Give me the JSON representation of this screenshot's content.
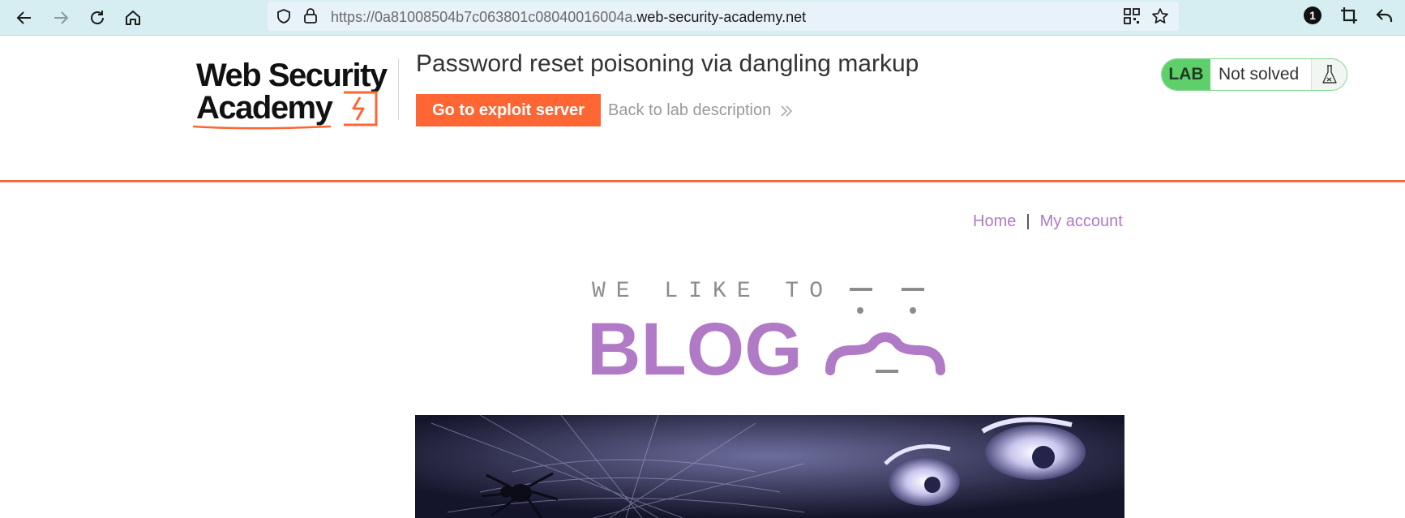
{
  "browser": {
    "url_prefix": "https://0a81008504b7c063801c08040016004a.",
    "url_domain": "web-security-academy.net",
    "badge_count": "1"
  },
  "lab": {
    "logo_line1": "Web Security",
    "logo_line2": "Academy",
    "title": "Password reset poisoning via dangling markup",
    "exploit_button": "Go to exploit server",
    "back_link": "Back to lab description",
    "status_label": "LAB",
    "status_value": "Not solved"
  },
  "site_nav": {
    "home": "Home",
    "separator": "|",
    "my_account": "My account"
  },
  "banner": {
    "tagline": "WE LIKE TO",
    "word": "BLOG"
  },
  "colors": {
    "accent_orange": "#ff6633",
    "link_purple": "#b07ac6",
    "lab_green": "#5fcf6c",
    "chrome_bg": "#d6eef1"
  }
}
